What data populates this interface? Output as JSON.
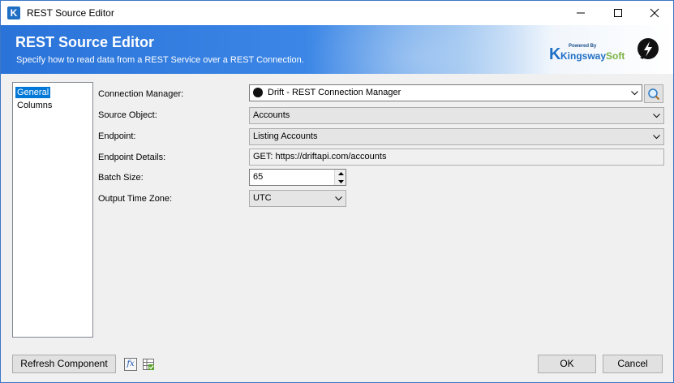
{
  "window": {
    "title": "REST Source Editor"
  },
  "banner": {
    "title": "REST Source Editor",
    "subtitle": "Specify how to read data from a REST Service over a REST Connection.",
    "powered_by": "Powered By",
    "brand_first": "Kingsway",
    "brand_second": "Soft"
  },
  "nav": {
    "items": [
      {
        "label": "General",
        "selected": true
      },
      {
        "label": "Columns",
        "selected": false
      }
    ]
  },
  "form": {
    "connection_manager": {
      "label": "Connection Manager:",
      "value": "Drift - REST Connection Manager"
    },
    "source_object": {
      "label": "Source Object:",
      "value": "Accounts"
    },
    "endpoint": {
      "label": "Endpoint:",
      "value": "Listing Accounts"
    },
    "endpoint_details": {
      "label": "Endpoint Details:",
      "value": "GET: https://driftapi.com/accounts"
    },
    "batch_size": {
      "label": "Batch Size:",
      "value": "65"
    },
    "output_time_zone": {
      "label": "Output Time Zone:",
      "value": "UTC"
    }
  },
  "footer": {
    "refresh_label": "Refresh Component",
    "ok_label": "OK",
    "cancel_label": "Cancel"
  },
  "icons": {
    "app": "kingswaysoft-k-icon",
    "drift": "drift-bolt-icon",
    "lookup": "magnifier-icon",
    "fx": "fx-expression-icon",
    "sheet": "spreadsheet-icon"
  },
  "colors": {
    "accent": "#0078d7",
    "banner": "#2a73d9"
  }
}
